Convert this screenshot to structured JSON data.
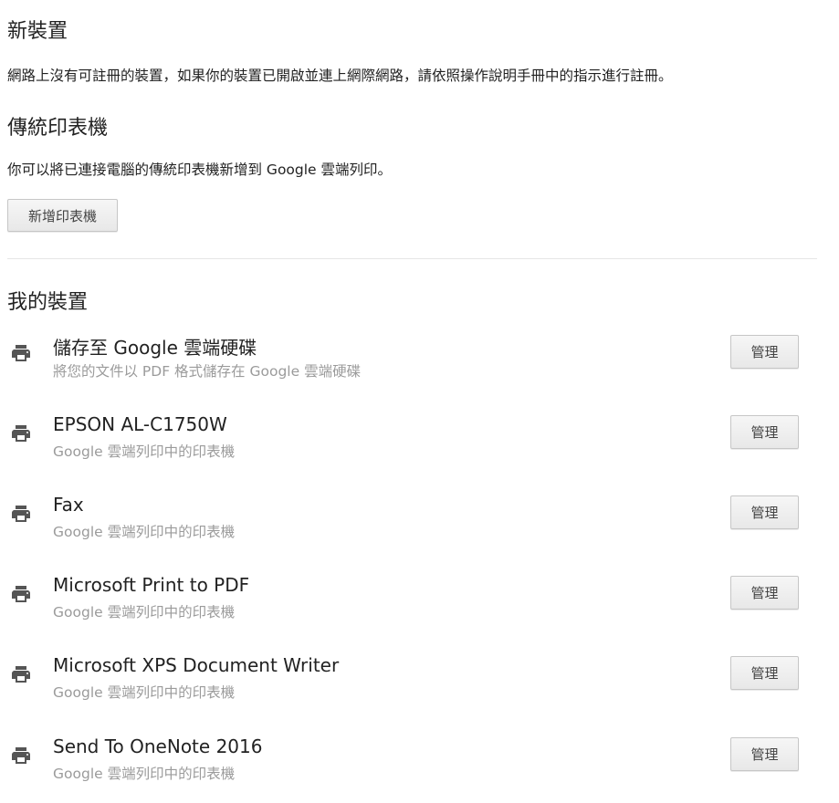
{
  "new_devices": {
    "title": "新裝置",
    "message": "網路上沒有可註冊的裝置，如果你的裝置已開啟並連上網際網路，請依照操作說明手冊中的指示進行註冊。"
  },
  "classic_printers": {
    "title": "傳統印表機",
    "message": "你可以將已連接電腦的傳統印表機新增到 Google 雲端列印。",
    "add_button_label": "新增印表機"
  },
  "my_devices": {
    "title": "我的裝置",
    "icon": "printer-icon",
    "items": [
      {
        "name": "儲存至 Google 雲端硬碟",
        "description": "將您的文件以 PDF 格式儲存在 Google 雲端硬碟",
        "manage_label": "管理"
      },
      {
        "name": "EPSON AL-C1750W",
        "description": "Google 雲端列印中的印表機",
        "manage_label": "管理"
      },
      {
        "name": "Fax",
        "description": "Google 雲端列印中的印表機",
        "manage_label": "管理"
      },
      {
        "name": "Microsoft Print to PDF",
        "description": "Google 雲端列印中的印表機",
        "manage_label": "管理"
      },
      {
        "name": "Microsoft XPS Document Writer",
        "description": "Google 雲端列印中的印表機",
        "manage_label": "管理"
      },
      {
        "name": "Send To OneNote 2016",
        "description": "Google 雲端列印中的印表機",
        "manage_label": "管理"
      }
    ]
  }
}
